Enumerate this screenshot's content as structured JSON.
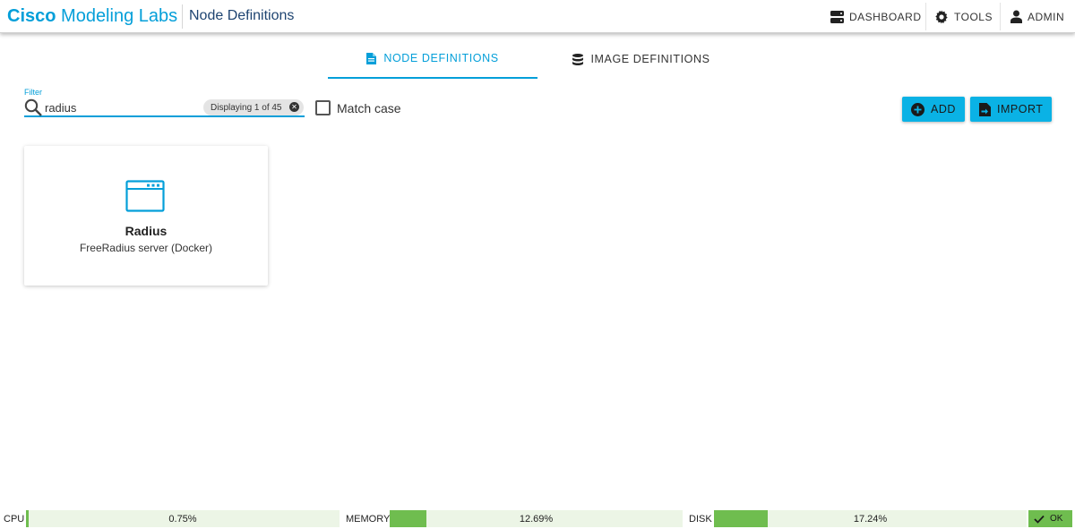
{
  "header": {
    "brand_bold": "Cisco",
    "brand_light": "Modeling Labs",
    "page_title": "Node Definitions",
    "nav": {
      "dashboard": "DASHBOARD",
      "tools": "TOOLS",
      "admin": "ADMIN"
    }
  },
  "tabs": [
    {
      "label": "NODE DEFINITIONS",
      "icon": "document-icon",
      "active": true
    },
    {
      "label": "IMAGE DEFINITIONS",
      "icon": "database-icon",
      "active": false
    }
  ],
  "filter": {
    "label": "Filter",
    "value": "radius",
    "result_chip": "Displaying 1 of 45"
  },
  "match_case": {
    "label": "Match case",
    "checked": false
  },
  "buttons": {
    "add": "ADD",
    "import": "IMPORT"
  },
  "cards": [
    {
      "title": "Radius",
      "subtitle": "FreeRadius server (Docker)",
      "icon": "browser-window-icon"
    }
  ],
  "status": {
    "cpu": {
      "label": "CPU",
      "value_text": "0.75%",
      "value": 0.75
    },
    "memory": {
      "label": "MEMORY",
      "value_text": "12.69%",
      "value": 12.69
    },
    "disk": {
      "label": "DISK",
      "value_text": "17.24%",
      "value": 17.24
    },
    "ok": "OK"
  },
  "colors": {
    "accent": "#049fd9",
    "button": "#0ab2e5",
    "gauge_fill": "#6fbd4f",
    "gauge_bg": "#ecf5e6"
  }
}
